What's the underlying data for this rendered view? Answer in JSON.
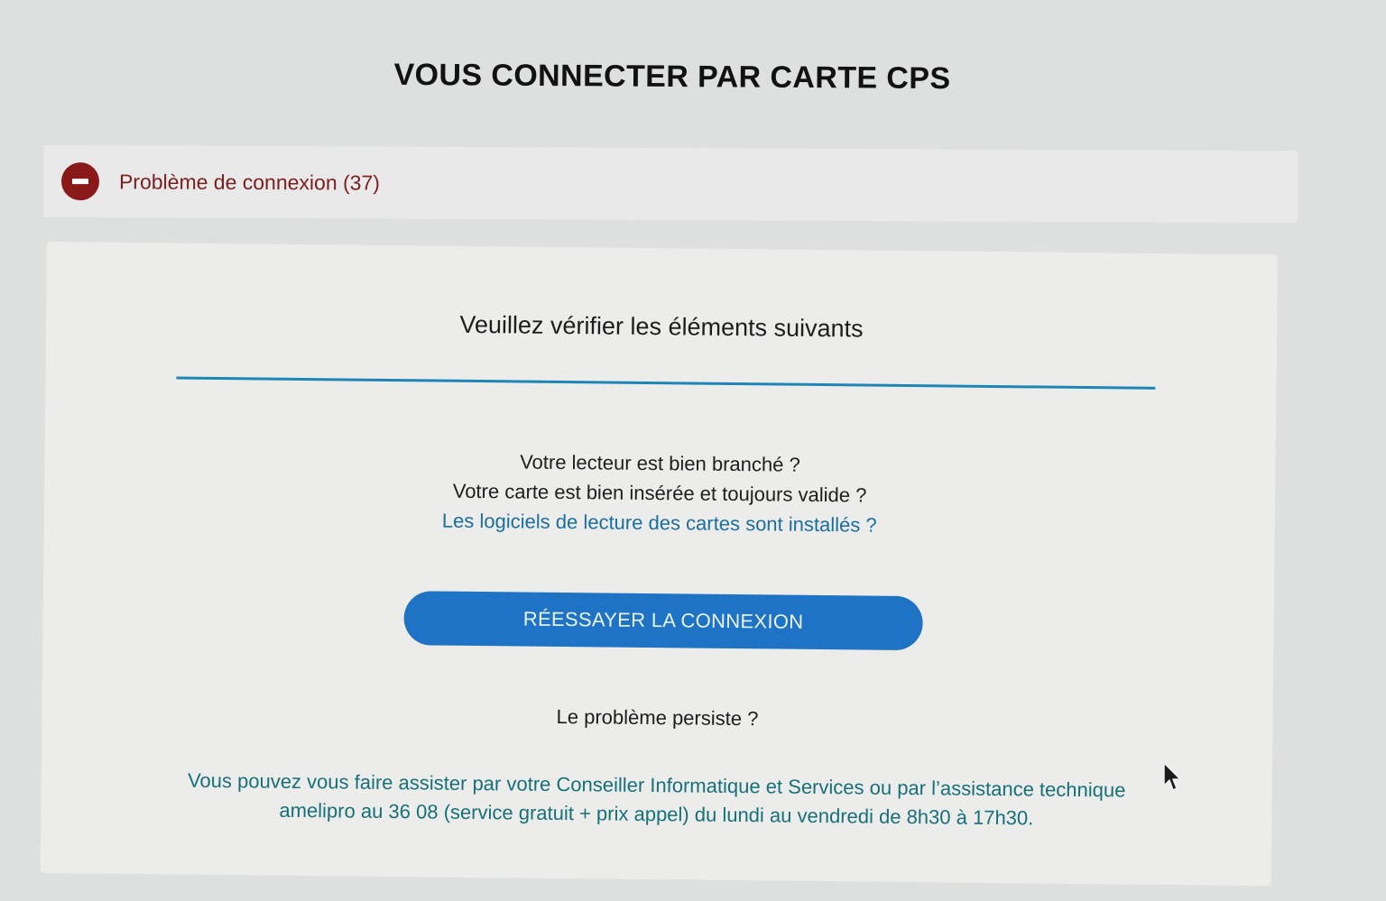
{
  "header": {
    "title": "VOUS CONNECTER PAR CARTE CPS"
  },
  "alert": {
    "icon": "no-entry-icon",
    "message": "Problème de connexion (37)",
    "color": "#8a1a1a"
  },
  "card": {
    "heading": "Veuillez vérifier les éléments suivants",
    "checks": [
      "Votre lecteur est bien branché ?",
      "Votre carte est bien insérée et toujours valide ?"
    ],
    "software_link": "Les logiciels de lecture des cartes sont installés ?",
    "retry_button": "RÉESSAYER LA CONNEXION",
    "persist_question": "Le problème persiste ?",
    "assistance": "Vous pouvez vous faire assister par votre Conseiller Informatique et Services ou par l’assistance technique amelipro au 36 08 (service gratuit + prix appel) du lundi au vendredi de 8h30 à 17h30."
  },
  "colors": {
    "accent": "#1e73c5",
    "divider": "#1d86b6",
    "link": "#1a6fa0",
    "assistance_text": "#16707a"
  }
}
